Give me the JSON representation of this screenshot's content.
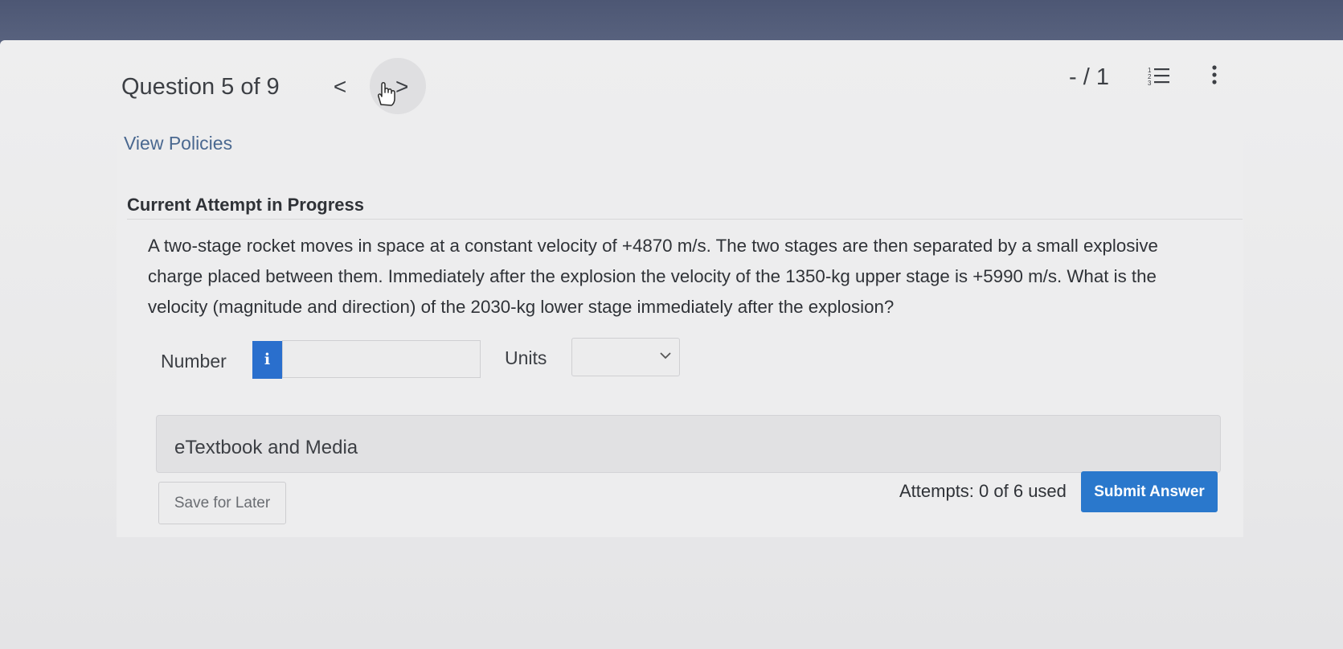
{
  "header": {
    "question_title": "Question 5 of 9",
    "prev_glyph": "<",
    "next_glyph": ">",
    "score": "- / 1"
  },
  "links": {
    "view_policies": "View Policies"
  },
  "attempt": {
    "heading": "Current Attempt in Progress"
  },
  "question": {
    "text": "A two-stage rocket moves in space at a constant velocity of +4870 m/s. The two stages are then separated by a small explosive charge placed between them. Immediately after the explosion the velocity of the 1350-kg upper stage is +5990 m/s. What is the velocity (magnitude and direction) of the 2030-kg lower stage immediately after the explosion?"
  },
  "answer": {
    "number_label": "Number",
    "info_glyph": "i",
    "number_value": "",
    "units_label": "Units",
    "units_value": ""
  },
  "etextbook": {
    "label": "eTextbook and Media"
  },
  "footer": {
    "save_label": "Save for Later",
    "attempts_text": "Attempts: 0 of 6 used",
    "submit_label": "Submit Answer"
  },
  "icons": {
    "list": "numbered-list-icon",
    "more": "kebab-menu-icon",
    "cursor": "hand-pointer-icon",
    "dropdown": "chevron-down-icon"
  },
  "colors": {
    "primary": "#2a78cc",
    "info": "#2a6fcd",
    "link": "#4a6890",
    "text": "#2f3237"
  }
}
